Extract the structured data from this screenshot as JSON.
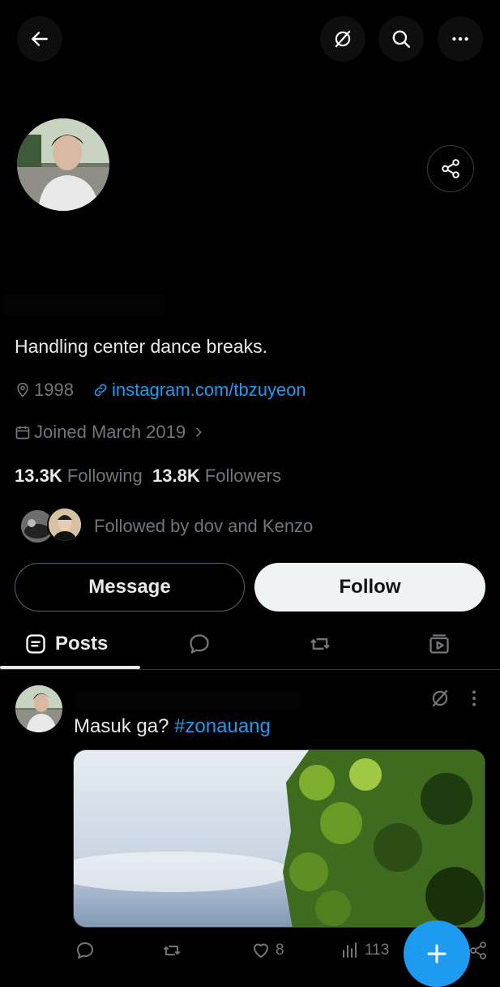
{
  "header": {
    "back_icon": "arrow-left-icon",
    "grok_icon": "grok-icon",
    "search_icon": "search-icon",
    "more_icon": "more-horizontal-icon"
  },
  "profile": {
    "bio": "Handling center dance breaks.",
    "location": "1998",
    "website": "instagram.com/tbzuyeon",
    "joined": "Joined March 2019",
    "following_count": "13.3K",
    "following_label": "Following",
    "followers_count": "13.8K",
    "followers_label": "Followers",
    "followed_by": "Followed by dov and Kenzo"
  },
  "actions": {
    "message_label": "Message",
    "follow_label": "Follow"
  },
  "tabs": [
    {
      "label": "Posts",
      "icon": "posts-icon"
    },
    {
      "label": "",
      "icon": "replies-icon"
    },
    {
      "label": "",
      "icon": "repost-icon"
    },
    {
      "label": "",
      "icon": "media-icon"
    }
  ],
  "post": {
    "text": "Masuk ga?",
    "hashtag": "#zonauang",
    "likes": "8",
    "views": "113"
  },
  "colors": {
    "accent": "#1d9bf0",
    "background": "#000000",
    "muted": "#71767b",
    "text": "#e7e9ea"
  }
}
